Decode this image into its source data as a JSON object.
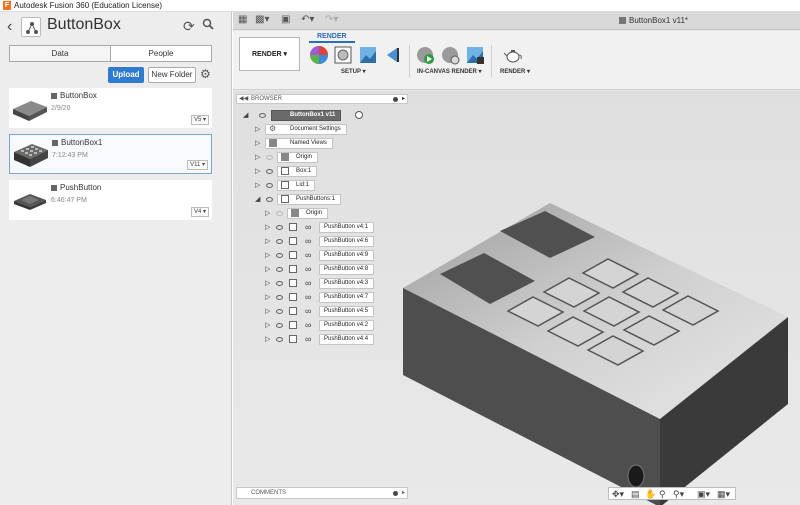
{
  "window": {
    "title": "Autodesk Fusion 360 (Education License)"
  },
  "data_panel": {
    "project_title": "ButtonBox",
    "tabs": [
      {
        "label": "Data",
        "active": true
      },
      {
        "label": "People",
        "active": false
      }
    ],
    "upload_label": "Upload",
    "new_folder_label": "New Folder",
    "files": [
      {
        "name": "ButtonBox",
        "date": "2/9/20",
        "version": "V5 ▾",
        "selected": false
      },
      {
        "name": "ButtonBox1",
        "date": "7:12:43 PM",
        "version": "V11 ▾",
        "selected": true
      },
      {
        "name": "PushButton",
        "date": "6:46:47 PM",
        "version": "V4 ▾",
        "selected": false
      }
    ]
  },
  "document": {
    "title": "ButtonBox1 v11*"
  },
  "ribbon": {
    "workspace": "RENDER ▾",
    "tab": "RENDER",
    "groups": [
      {
        "label": "SETUP ▾"
      },
      {
        "label": "IN-CANVAS RENDER ▾"
      },
      {
        "label": "RENDER ▾"
      }
    ]
  },
  "browser": {
    "title": "BROWSER",
    "root": "ButtonBox1 v11",
    "nodes": [
      {
        "label": "Document Settings"
      },
      {
        "label": "Named Views"
      },
      {
        "label": "Origin"
      },
      {
        "label": "Box:1"
      },
      {
        "label": "Lid:1"
      },
      {
        "label": "PushButtons:1"
      },
      {
        "label": "Origin"
      },
      {
        "label": "PushButton v4:1"
      },
      {
        "label": "PushButton v4:6"
      },
      {
        "label": "PushButton v4:9"
      },
      {
        "label": "PushButton v4:8"
      },
      {
        "label": "PushButton v4:3"
      },
      {
        "label": "PushButton v4:7"
      },
      {
        "label": "PushButton v4:5"
      },
      {
        "label": "PushButton v4:2"
      },
      {
        "label": "PushButton v4:4"
      }
    ]
  },
  "comments": {
    "title": "COMMENTS"
  },
  "icons": {
    "back": "chevron-left-icon",
    "refresh": "refresh-icon",
    "search": "search-icon",
    "settings": "gear-icon"
  }
}
